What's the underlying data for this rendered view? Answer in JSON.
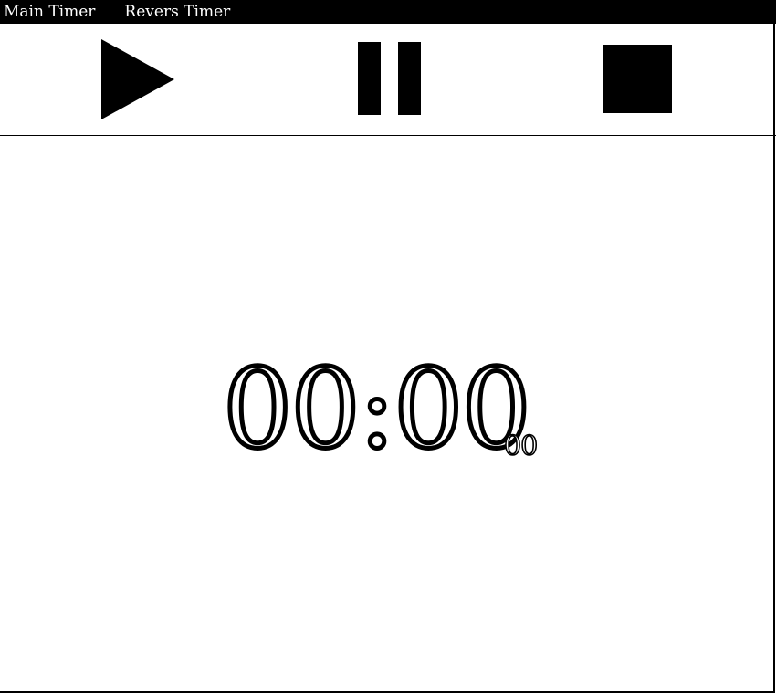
{
  "menu": {
    "main_timer_label": "Main Timer",
    "revers_timer_label": "Revers Timer"
  },
  "controls": {
    "play_icon": "play-icon",
    "pause_icon": "pause-icon",
    "stop_icon": "stop-icon"
  },
  "timer": {
    "display": "00:00",
    "fraction": "00"
  },
  "colors": {
    "menubar_background": "#000000",
    "menubar_text": "#ffffff",
    "icon_fill": "#000000",
    "background": "#ffffff"
  }
}
